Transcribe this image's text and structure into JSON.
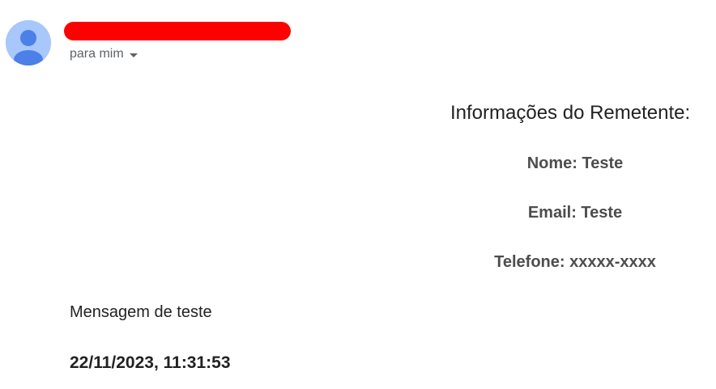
{
  "header": {
    "avatar_icon": "default-person-avatar-icon",
    "sender_name_redacted": true,
    "redaction_color": "#ff0000",
    "recipient_label": "para mim",
    "recipient_dropdown_icon": "caret-down-icon"
  },
  "sender_info": {
    "title": "Informações do Remetente:",
    "name_line": "Nome: Teste",
    "email_line": "Email: Teste",
    "phone_line": "Telefone: xxxxx-xxxx"
  },
  "message": {
    "text": "Mensagem de teste",
    "timestamp": "22/11/2023, 11:31:53"
  },
  "colors": {
    "avatar_background": "#a8c7fa",
    "avatar_figure": "#4a80e8",
    "secondary_text": "#5f6368",
    "info_text": "#4d4d4d",
    "body_text": "#222222"
  }
}
